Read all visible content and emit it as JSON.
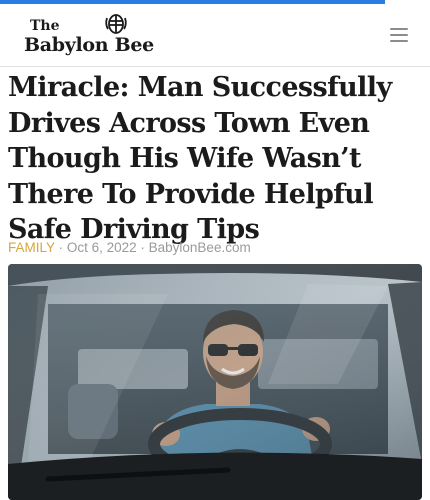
{
  "header": {
    "logo_the": "The",
    "logo_name": "Babylon Bee",
    "logo_icon": "bee-icon",
    "menu_icon": "hamburger-menu-icon"
  },
  "article": {
    "headline": "Miracle: Man Successfully Drives Across Town Even Though His Wife Wasn’t There To Provide Helpful Safe Driving Tips",
    "category": "FAMILY",
    "separator": "·",
    "date": "Oct 6, 2022",
    "source": "BabylonBee.com"
  },
  "colors": {
    "progress_bar": "#2a7de1",
    "category": "#d9a63a",
    "meta_text": "#9a9a9a",
    "headline_text": "#1b1b1b"
  }
}
